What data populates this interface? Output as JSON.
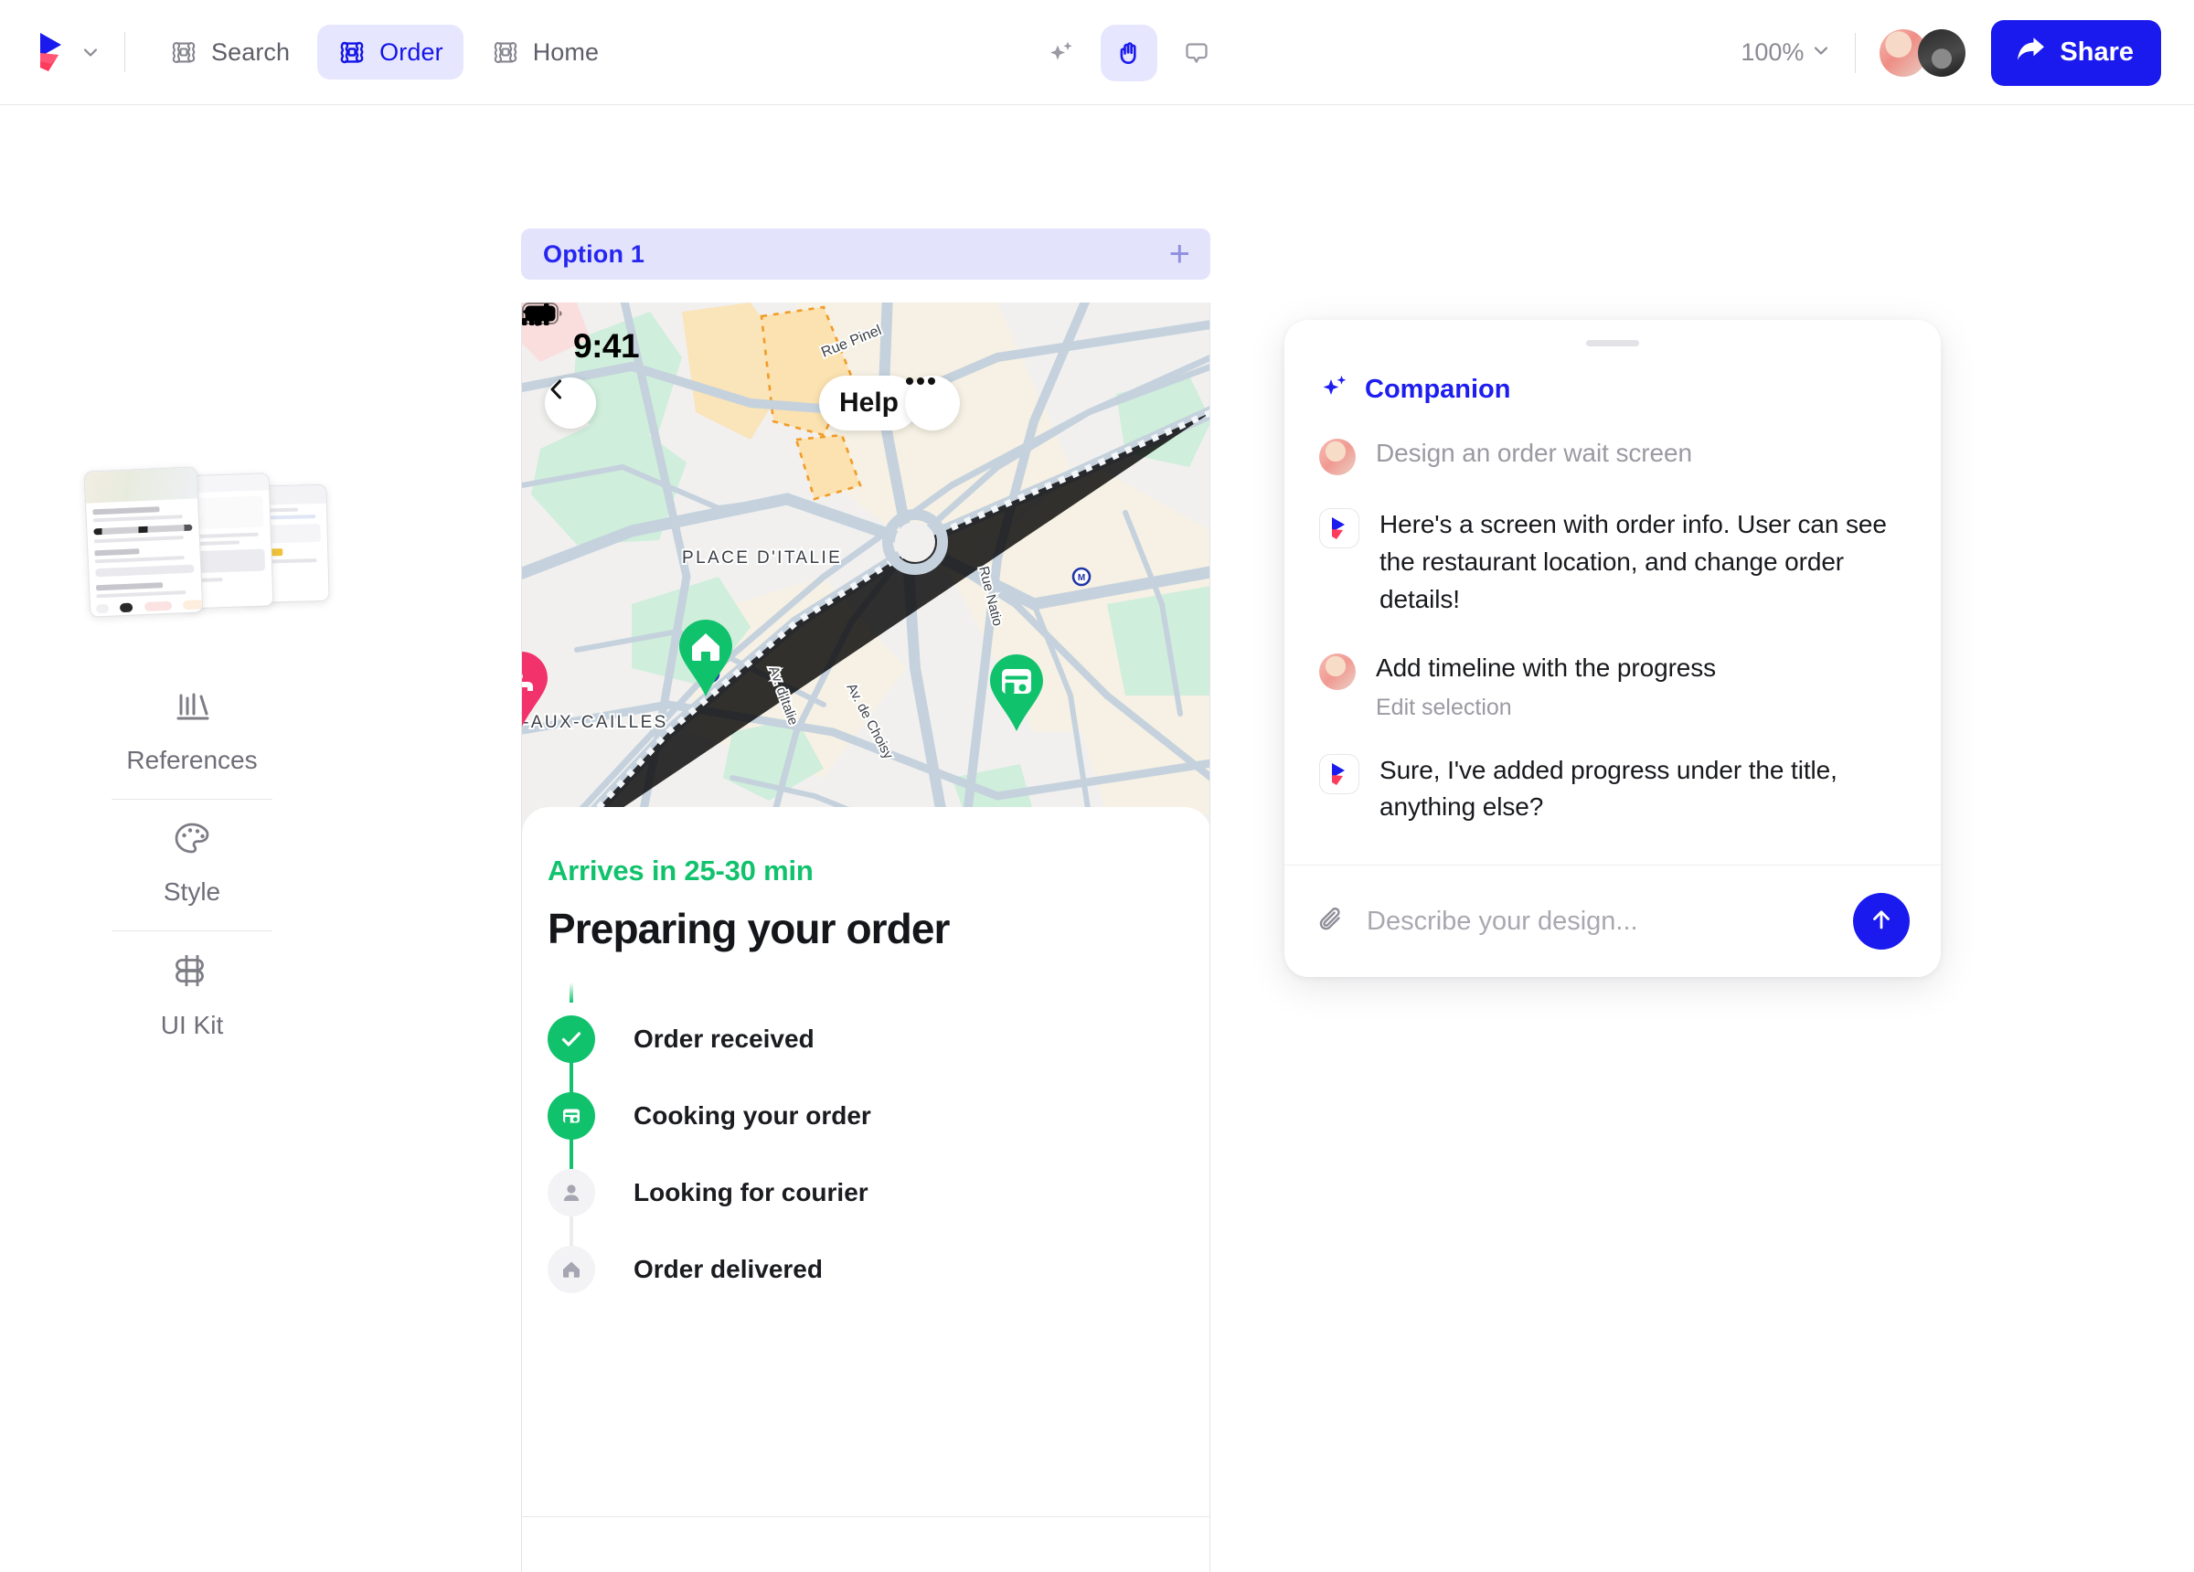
{
  "app": {
    "brand_color": "#1a1aee",
    "accent_green": "#11c26d",
    "tab_active_bg": "#e6e6ff"
  },
  "topbar": {
    "logo_name": "play-logo-icon",
    "logo_caret": "chevron-down-icon",
    "tabs": [
      {
        "label": "Search",
        "icon": "frame-icon",
        "active": false
      },
      {
        "label": "Order",
        "icon": "frame-icon",
        "active": true
      },
      {
        "label": "Home",
        "icon": "frame-icon",
        "active": false
      }
    ],
    "tools": [
      {
        "name": "sparkle-ai-icon",
        "active": false
      },
      {
        "name": "hand-tool-icon",
        "active": true
      },
      {
        "name": "comment-icon",
        "active": false
      }
    ],
    "zoom_level": "100%",
    "zoom_caret": "chevron-down-icon",
    "share_label": "Share",
    "share_icon": "share-arrow-icon",
    "avatars": [
      "collaborator-avatar-1",
      "collaborator-avatar-2"
    ]
  },
  "sidebar": {
    "thumbnail_name": "references-thumbnail-stack",
    "items": [
      {
        "label": "References",
        "icon": "books-icon"
      },
      {
        "label": "Style",
        "icon": "palette-icon"
      },
      {
        "label": "UI Kit",
        "icon": "figma-component-icon"
      }
    ]
  },
  "canvas": {
    "option_bar": {
      "title": "Option 1",
      "add_icon": "plus-icon"
    },
    "phone": {
      "status_bar": {
        "time": "9:41",
        "icons": [
          "cellular-signal-icon",
          "wifi-icon",
          "battery-icon"
        ]
      },
      "map": {
        "labels": [
          "PLACE D'ITALIE",
          "Rue Pinel",
          "Av. d'Italie",
          "Av. de Choisy",
          "Rue Natio",
          "TE-AUX-CAILLES"
        ],
        "back_icon": "chevron-left-icon",
        "help_label": "Help",
        "more_icon": "ellipsis-icon",
        "pins": [
          {
            "name": "home-pin",
            "icon": "home-icon",
            "color": "#11c26d"
          },
          {
            "name": "restaurant-pin",
            "icon": "storefront-icon",
            "color": "#11c26d"
          },
          {
            "name": "secondary-pin",
            "icon": "bed-icon",
            "color": "#f2336b"
          }
        ]
      },
      "sheet": {
        "eta": "Arrives in 25-30 min",
        "title": "Preparing your order",
        "timeline": [
          {
            "label": "Order received",
            "icon": "check-icon",
            "state": "done"
          },
          {
            "label": "Cooking your order",
            "icon": "storefront-icon",
            "state": "done"
          },
          {
            "label": "Looking for courier",
            "icon": "person-icon",
            "state": "todo"
          },
          {
            "label": "Order delivered",
            "icon": "home-icon",
            "state": "todo"
          }
        ]
      }
    }
  },
  "companion": {
    "title": "Companion",
    "title_icon": "sparkle-ai-icon",
    "messages": [
      {
        "author": "user",
        "text": "Design an order wait screen",
        "muted": true,
        "sub": null
      },
      {
        "author": "assistant",
        "text": "Here's a screen with order info. User can see the restaurant location, and change order details!",
        "muted": false,
        "sub": null
      },
      {
        "author": "user",
        "text": "Add timeline with the progress",
        "muted": false,
        "sub": "Edit selection"
      },
      {
        "author": "assistant",
        "text": "Sure, I've added progress under the title, anything else?",
        "muted": false,
        "sub": null
      }
    ],
    "composer": {
      "attach_icon": "paperclip-icon",
      "placeholder": "Describe your design...",
      "value": "",
      "send_icon": "arrow-up-icon"
    }
  }
}
